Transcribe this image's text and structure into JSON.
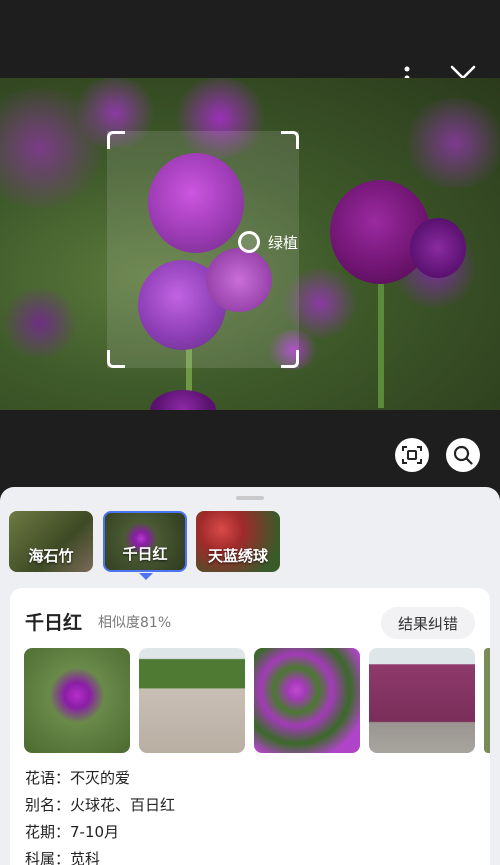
{
  "tag": {
    "label": "绿植"
  },
  "tabs": [
    {
      "label": "海石竹",
      "color": "#5f6e3a"
    },
    {
      "label": "千日红",
      "color": "#4a5a33"
    },
    {
      "label": "天蓝绣球",
      "color": "#a03a3a"
    }
  ],
  "result": {
    "name": "千日红",
    "similarity": "相似度81%",
    "correct_button": "结果纠错"
  },
  "details": [
    {
      "text": "花语：不灭的爱"
    },
    {
      "text": "别名：火球花、百日红"
    },
    {
      "text": "花期：7-10月"
    },
    {
      "text": "科属：苋科"
    }
  ],
  "icons": [
    "more-vertical-icon",
    "close-icon",
    "scan-icon",
    "search-icon"
  ],
  "accent": "#4b73f2"
}
